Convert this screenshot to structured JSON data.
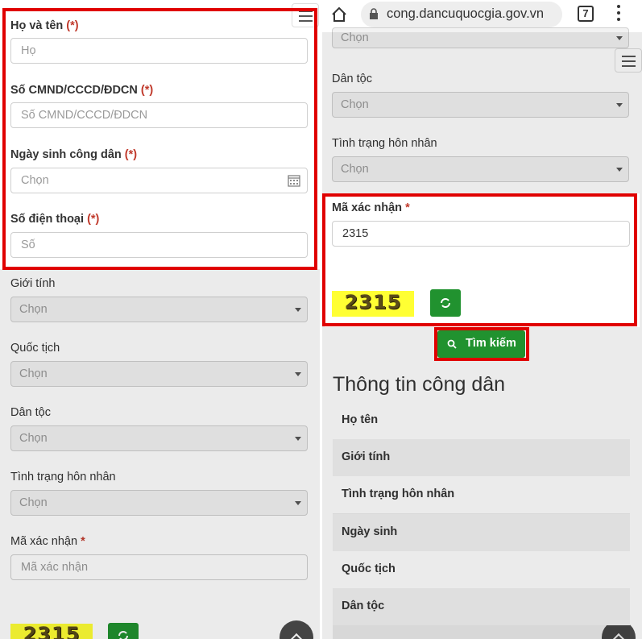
{
  "left": {
    "fields": {
      "name_label": "Họ và tên",
      "name_placeholder": "Họ",
      "id_label": "Số CMND/CCCD/ĐDCN",
      "id_placeholder": "Số CMND/CCCD/ĐDCN",
      "dob_label": "Ngày sinh công dân",
      "dob_placeholder": "Chọn",
      "phone_label": "Số điện thoại",
      "phone_placeholder": "Số",
      "required_mark": "(*)"
    },
    "selects": [
      {
        "label": "Giới tính",
        "value": "Chọn"
      },
      {
        "label": "Quốc tịch",
        "value": "Chọn"
      },
      {
        "label": "Dân tộc",
        "value": "Chọn"
      },
      {
        "label": "Tình trạng hôn nhân",
        "value": "Chọn"
      }
    ],
    "captcha_label": "Mã xác nhận",
    "captcha_star": "*",
    "captcha_placeholder": "Mã xác nhận",
    "captcha_code": "2315"
  },
  "right": {
    "browser": {
      "url": "cong.dancuquocgia.gov.vn",
      "tab_count": "7"
    },
    "selects": [
      {
        "label": "",
        "value": "Chọn"
      },
      {
        "label": "Dân tộc",
        "value": "Chọn"
      },
      {
        "label": "Tình trạng hôn nhân",
        "value": "Chọn"
      }
    ],
    "captcha_label": "Mã xác nhận",
    "captcha_star": "*",
    "captcha_value": "2315",
    "captcha_code": "2315",
    "search_button": "Tìm kiếm",
    "section_title": "Thông tin công dân",
    "info_rows": [
      "Họ tên",
      "Giới tính",
      "Tình trạng hôn nhân",
      "Ngày sinh",
      "Quốc tịch",
      "Dân tộc"
    ]
  },
  "colors": {
    "highlight": "#e00000",
    "button_green": "#21922f",
    "captcha_bg": "#ffff33"
  }
}
